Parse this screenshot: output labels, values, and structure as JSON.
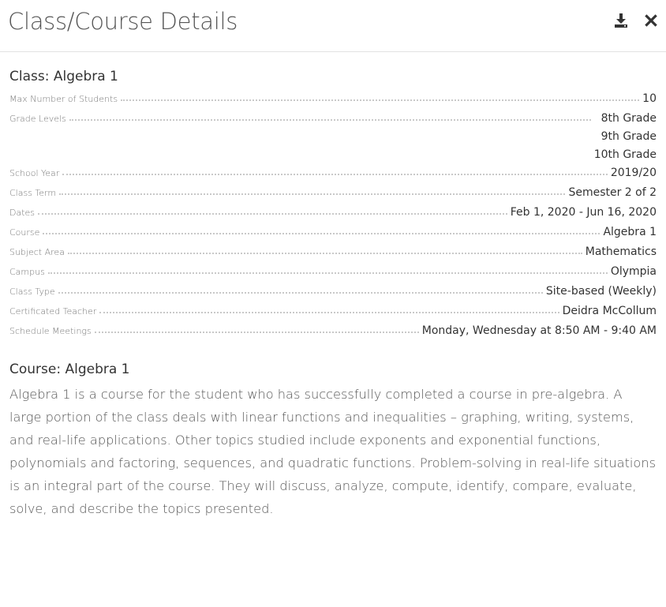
{
  "header": {
    "title": "Class/Course Details",
    "actions": {
      "download_icon": "download-icon",
      "close_icon": "close-icon"
    }
  },
  "class_section": {
    "title": "Class: Algebra 1",
    "details": [
      {
        "label": "Max Number of Students",
        "value": "10"
      },
      {
        "label": "Grade Levels",
        "values": [
          "8th Grade",
          "9th Grade",
          "10th Grade"
        ]
      },
      {
        "label": "School Year",
        "value": "2019/20"
      },
      {
        "label": "Class Term",
        "value": "Semester 2 of 2"
      },
      {
        "label": "Dates",
        "value": "Feb 1, 2020 - Jun 16, 2020"
      },
      {
        "label": "Course",
        "value": "Algebra 1"
      },
      {
        "label": "Subject Area",
        "value": "Mathematics"
      },
      {
        "label": "Campus",
        "value": "Olympia"
      },
      {
        "label": "Class Type",
        "value": "Site-based (Weekly)"
      },
      {
        "label": "Certificated Teacher",
        "value": "Deidra McCollum"
      },
      {
        "label": "Schedule Meetings",
        "value": "Monday, Wednesday at 8:50 AM - 9:40 AM"
      }
    ]
  },
  "course_section": {
    "title": "Course: Algebra 1",
    "description": "Algebra 1 is a course for the student who has successfully completed a course in pre-algebra. A large portion of the class deals with linear functions and inequalities – graphing, writing, systems, and real-life applications. Other topics studied include exponents and exponential functions, polynomials and factoring, sequences, and quadratic functions. Problem-solving in real-life situations is an integral part of the course. They will discuss, analyze, compute, identify, compare, evaluate, solve, and describe the topics presented."
  }
}
